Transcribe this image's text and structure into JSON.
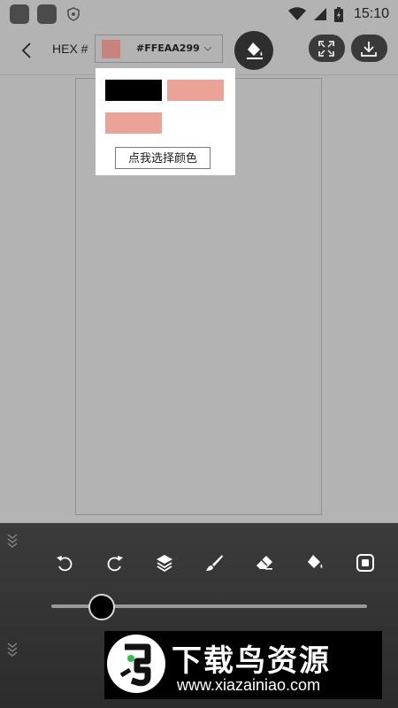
{
  "status_bar": {
    "time": "15:10",
    "icons": [
      "app-icon",
      "app-icon",
      "shield-icon",
      "wifi-icon",
      "signal-icon",
      "battery-icon"
    ]
  },
  "toolbar": {
    "hex_label": "HEX #",
    "current_color_hex": "#FFEAA299",
    "current_color": "#c8837c",
    "icons": [
      "back-arrow-icon",
      "chevron-down-icon",
      "paint-bucket-icon",
      "fullscreen-icon",
      "download-icon"
    ]
  },
  "color_popup": {
    "swatches": [
      "#000000",
      "#eba297",
      "#eba297"
    ],
    "pick_button_label": "点我选择颜色"
  },
  "bottom_panel": {
    "tools": [
      "undo-icon",
      "redo-icon",
      "layers-icon",
      "brush-icon",
      "eraser-icon",
      "fill-icon",
      "crop-icon"
    ],
    "brush_size_fraction": 0.16
  },
  "watermark": {
    "title": "下载鸟资源",
    "url": "www.xiazainiao.com"
  }
}
